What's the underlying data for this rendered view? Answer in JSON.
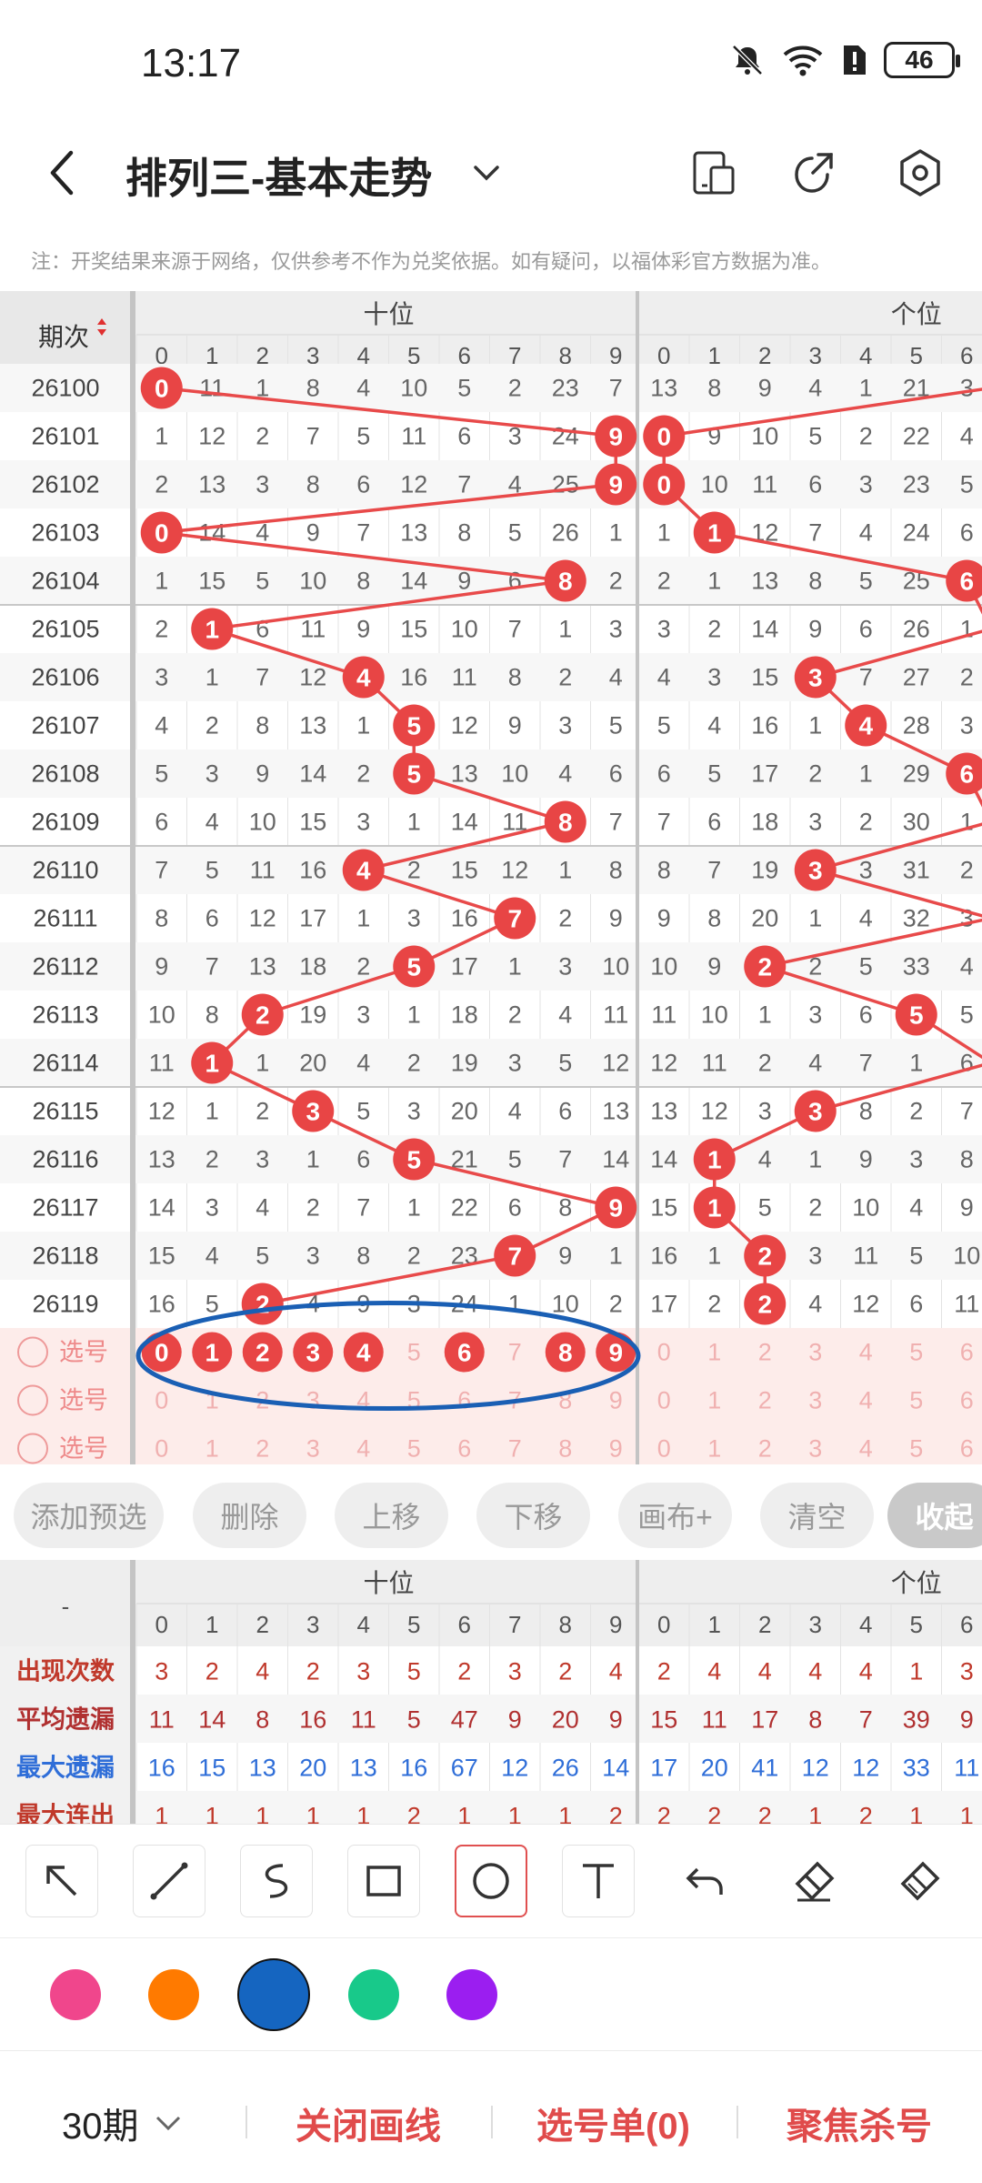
{
  "status_bar": {
    "time": "13:17",
    "battery": "46",
    "icons": [
      "bell-off-icon",
      "wifi-icon",
      "sim-alert-icon",
      "battery-icon"
    ]
  },
  "header": {
    "title": "排列三-基本走势",
    "icons": [
      "back-icon",
      "chevron-down-icon",
      "phone-layout-icon",
      "share-icon",
      "settings-hex-icon"
    ]
  },
  "notice": "注：开奖结果来源于网络，仅供参考不作为兑奖依据。如有疑问，以福体彩官方数据为准。",
  "chart_data": {
    "type": "table",
    "col_group_1": "十位",
    "col_group_2": "个位",
    "period_header": "期次",
    "digits": [
      "0",
      "1",
      "2",
      "3",
      "4",
      "5",
      "6",
      "7",
      "8",
      "9"
    ],
    "rows": [
      {
        "p": "26100",
        "t": [
          0,
          11,
          1,
          8,
          4,
          10,
          5,
          2,
          23,
          7
        ],
        "g": [
          13,
          8,
          9,
          4,
          1,
          21,
          3
        ],
        "th": 0,
        "gh": null
      },
      {
        "p": "26101",
        "t": [
          1,
          12,
          2,
          7,
          5,
          11,
          6,
          3,
          24,
          9
        ],
        "g": [
          0,
          9,
          10,
          5,
          2,
          22,
          4
        ],
        "th": 9,
        "gh": 0
      },
      {
        "p": "26102",
        "t": [
          2,
          13,
          3,
          8,
          6,
          12,
          7,
          4,
          25,
          9
        ],
        "g": [
          0,
          10,
          11,
          6,
          3,
          23,
          5
        ],
        "th": 9,
        "gh": 0
      },
      {
        "p": "26103",
        "t": [
          0,
          14,
          4,
          9,
          7,
          13,
          8,
          5,
          26,
          1
        ],
        "g": [
          1,
          1,
          12,
          7,
          4,
          24,
          6
        ],
        "th": 0,
        "gh": 1
      },
      {
        "p": "26104",
        "t": [
          1,
          15,
          5,
          10,
          8,
          14,
          9,
          6,
          8,
          2
        ],
        "g": [
          2,
          1,
          13,
          8,
          5,
          25,
          6
        ],
        "th": 8,
        "gh": 6
      },
      {
        "p": "26105",
        "t": [
          2,
          1,
          6,
          11,
          9,
          15,
          10,
          7,
          1,
          3
        ],
        "g": [
          3,
          2,
          14,
          9,
          6,
          26,
          1
        ],
        "th": 1,
        "gh": null
      },
      {
        "p": "26106",
        "t": [
          3,
          1,
          7,
          12,
          4,
          16,
          11,
          8,
          2,
          4
        ],
        "g": [
          4,
          3,
          15,
          3,
          7,
          27,
          2
        ],
        "th": 4,
        "gh": 3
      },
      {
        "p": "26107",
        "t": [
          4,
          2,
          8,
          13,
          1,
          5,
          12,
          9,
          3,
          5
        ],
        "g": [
          5,
          4,
          16,
          1,
          4,
          28,
          3
        ],
        "th": 5,
        "gh": 4
      },
      {
        "p": "26108",
        "t": [
          5,
          3,
          9,
          14,
          2,
          5,
          13,
          10,
          4,
          6
        ],
        "g": [
          6,
          5,
          17,
          2,
          1,
          29,
          6
        ],
        "th": 5,
        "gh": 6
      },
      {
        "p": "26109",
        "t": [
          6,
          4,
          10,
          15,
          3,
          1,
          14,
          11,
          8,
          7
        ],
        "g": [
          7,
          6,
          18,
          3,
          2,
          30,
          1
        ],
        "th": 8,
        "gh": null
      },
      {
        "p": "26110",
        "t": [
          7,
          5,
          11,
          16,
          4,
          2,
          15,
          12,
          1,
          8
        ],
        "g": [
          8,
          7,
          19,
          3,
          3,
          31,
          2
        ],
        "th": 4,
        "gh": 3
      },
      {
        "p": "26111",
        "t": [
          8,
          6,
          12,
          17,
          1,
          3,
          16,
          7,
          2,
          9
        ],
        "g": [
          9,
          8,
          20,
          1,
          4,
          32,
          3
        ],
        "th": 7,
        "gh": null
      },
      {
        "p": "26112",
        "t": [
          9,
          7,
          13,
          18,
          2,
          5,
          17,
          1,
          3,
          10
        ],
        "g": [
          10,
          9,
          2,
          2,
          5,
          33,
          4
        ],
        "th": 5,
        "gh": 2
      },
      {
        "p": "26113",
        "t": [
          10,
          8,
          2,
          19,
          3,
          1,
          18,
          2,
          4,
          11
        ],
        "g": [
          11,
          10,
          1,
          3,
          6,
          5,
          5
        ],
        "th": 2,
        "gh": 5
      },
      {
        "p": "26114",
        "t": [
          11,
          1,
          1,
          20,
          4,
          2,
          19,
          3,
          5,
          12
        ],
        "g": [
          12,
          11,
          2,
          4,
          7,
          1,
          6
        ],
        "th": 1,
        "gh": null
      },
      {
        "p": "26115",
        "t": [
          12,
          1,
          2,
          3,
          5,
          3,
          20,
          4,
          6,
          13
        ],
        "g": [
          13,
          12,
          3,
          3,
          8,
          2,
          7
        ],
        "th": 3,
        "gh": 3
      },
      {
        "p": "26116",
        "t": [
          13,
          2,
          3,
          1,
          6,
          5,
          21,
          5,
          7,
          14
        ],
        "g": [
          14,
          1,
          4,
          1,
          9,
          3,
          8
        ],
        "th": 5,
        "gh": 1
      },
      {
        "p": "26117",
        "t": [
          14,
          3,
          4,
          2,
          7,
          1,
          22,
          6,
          8,
          9
        ],
        "g": [
          15,
          1,
          5,
          2,
          10,
          4,
          9
        ],
        "th": 9,
        "gh": 1
      },
      {
        "p": "26118",
        "t": [
          15,
          4,
          5,
          3,
          8,
          2,
          23,
          7,
          9,
          1
        ],
        "g": [
          16,
          1,
          2,
          3,
          11,
          5,
          10
        ],
        "th": 7,
        "gh": 2
      },
      {
        "p": "26119",
        "t": [
          16,
          5,
          2,
          4,
          9,
          3,
          24,
          1,
          10,
          2
        ],
        "g": [
          17,
          2,
          2,
          4,
          12,
          6,
          11
        ],
        "th": 2,
        "gh": 2
      }
    ],
    "select_label": "选号",
    "selected_tens": [
      0,
      1,
      2,
      3,
      4,
      6,
      8,
      9
    ],
    "annotation": "blue-ellipse-around-selected-row"
  },
  "actions": [
    "添加预选",
    "删除",
    "上移",
    "下移",
    "画布+",
    "清空",
    "收起"
  ],
  "stats": {
    "corner": "-",
    "rows": [
      {
        "label": "出现次数",
        "color": "#c0392b",
        "t": [
          3,
          2,
          4,
          2,
          3,
          5,
          2,
          3,
          2,
          4
        ],
        "g": [
          2,
          4,
          4,
          4,
          4,
          1,
          3
        ]
      },
      {
        "label": "平均遗漏",
        "color": "#b03030",
        "t": [
          11,
          14,
          8,
          16,
          11,
          5,
          47,
          9,
          20,
          9
        ],
        "g": [
          15,
          11,
          17,
          8,
          7,
          39,
          9
        ]
      },
      {
        "label": "最大遗漏",
        "color": "#2f6ed8",
        "t": [
          16,
          15,
          13,
          20,
          13,
          16,
          67,
          12,
          26,
          14
        ],
        "g": [
          17,
          20,
          41,
          12,
          12,
          33,
          11
        ]
      },
      {
        "label": "最大连出",
        "color": "#c0392b",
        "t": [
          1,
          1,
          1,
          1,
          1,
          2,
          1,
          1,
          1,
          2
        ],
        "g": [
          2,
          2,
          2,
          1,
          2,
          1,
          1
        ]
      }
    ]
  },
  "draw_tools": [
    "arrow-icon",
    "line-icon",
    "curve-icon",
    "rectangle-icon",
    "circle-icon",
    "text-icon",
    "undo-icon",
    "eraser-icon",
    "brush-icon"
  ],
  "draw_colors": [
    "#f0468c",
    "#ff7a00",
    "#1565c0",
    "#18c98a",
    "#9b1ef0"
  ],
  "bottom": {
    "period": "30期",
    "close_lines": "关闭画线",
    "pick_list": "选号单(0)",
    "focus_kill": "聚焦杀号"
  }
}
